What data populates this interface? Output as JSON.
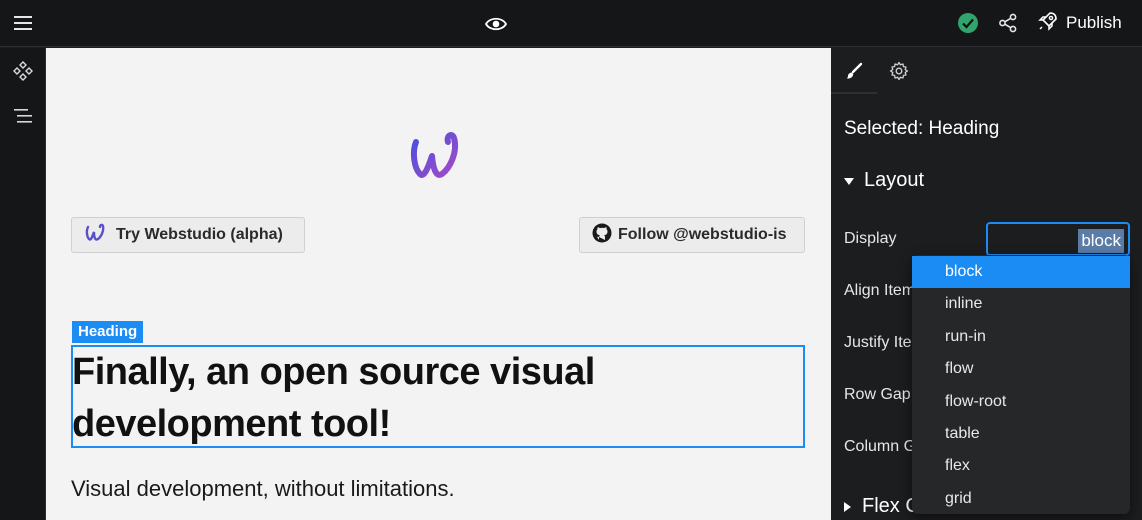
{
  "topbar": {
    "menu_icon": "hamburger-menu-icon",
    "preview_icon": "eye-icon",
    "status_icon": "check-circle-icon",
    "share_icon": "share-icon",
    "publish_icon": "rocket-icon",
    "publish_label": "Publish",
    "status_color": "#30a46c"
  },
  "leftbar": {
    "components_icon": "components-icon",
    "navigator_icon": "navigator-icon"
  },
  "canvas": {
    "try_button_label": "Try Webstudio (alpha)",
    "follow_button_label": "Follow @webstudio-is",
    "selected_badge": "Heading",
    "heading": "Finally, an open source visual development tool!",
    "subtext": "Visual development, without limitations.",
    "accent_color": "#1c8cf5"
  },
  "panel": {
    "style_tab_icon": "paintbrush-icon",
    "settings_tab_icon": "gear-icon",
    "selected_label": "Selected: Heading",
    "layout_section": "Layout",
    "display_label": "Display",
    "display_value": "block",
    "align_items_label": "Align Item",
    "justify_items_label": "Justify Ite",
    "row_gap_label": "Row Gap",
    "column_gap_label": "Column G",
    "flex_section": "Flex C"
  },
  "dropdown": {
    "options": [
      "block",
      "inline",
      "run-in",
      "flow",
      "flow-root",
      "table",
      "flex",
      "grid"
    ],
    "selected": "block"
  }
}
